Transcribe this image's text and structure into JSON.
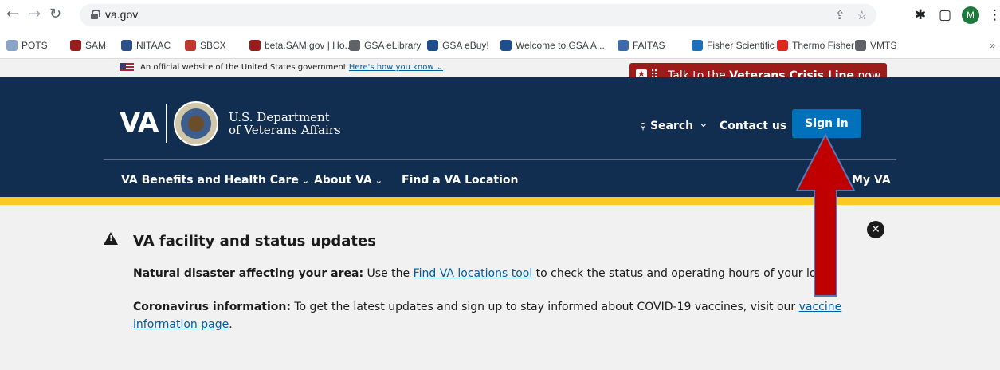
{
  "browser": {
    "url": "va.gov",
    "bookmarks": [
      {
        "label": "POTS",
        "icon_color": "#8aa4c9"
      },
      {
        "label": "SAM",
        "icon_color": "#9a1c1c"
      },
      {
        "label": "NITAAC",
        "icon_color": "#2d4f8a"
      },
      {
        "label": "SBCX",
        "icon_color": "#c2362d"
      },
      {
        "label": "beta.SAM.gov | Ho...",
        "icon_color": "#9a1c1c"
      },
      {
        "label": "GSA eLibrary",
        "icon_color": "#5f6368"
      },
      {
        "label": "GSA eBuy!",
        "icon_color": "#1f4e8c"
      },
      {
        "label": "Welcome to GSA A...",
        "icon_color": "#1f4e8c"
      },
      {
        "label": "FAITAS",
        "icon_color": "#3d6aa8"
      },
      {
        "label": "Fisher Scientific",
        "icon_color": "#1c6fb8"
      },
      {
        "label": "Thermo Fisher",
        "icon_color": "#e1251b"
      },
      {
        "label": "VMTS",
        "icon_color": "#5f6368"
      }
    ],
    "bookmarks_overflow": "»",
    "avatar_initial": "M"
  },
  "gov_banner": {
    "text": "An official website of the United States government",
    "link": "Here's how you know"
  },
  "crisis_line": {
    "prefix": "Talk to the",
    "strong": "Veterans Crisis Line",
    "suffix": "now"
  },
  "header": {
    "logo": "VA",
    "dept_line1": "U.S. Department",
    "dept_line2": "of Veterans Affairs",
    "search_label": "Search",
    "contact_label": "Contact us",
    "signin_label": "Sign in"
  },
  "nav": {
    "items": [
      {
        "label": "VA Benefits and Health Care"
      },
      {
        "label": "About VA"
      },
      {
        "label": "Find a VA Location"
      },
      {
        "label": "My VA"
      }
    ]
  },
  "alert": {
    "title": "VA facility and status updates",
    "p1_strong": "Natural disaster affecting your area:",
    "p1_pre": " Use the ",
    "p1_link": "Find VA locations tool",
    "p1_post": " to check the status and operating hours of your local VA facility.",
    "p2_strong": "Coronavirus information:",
    "p2_pre": " To get the latest updates and sign up to stay informed about COVID-19 vaccines, visit our ",
    "p2_link_line1": "vaccine",
    "p2_link_line2": "information page",
    "p2_post": "."
  },
  "colors": {
    "header_bg": "#112e51",
    "signin_bg": "#0071bb",
    "crisis_bg": "#9c1c1c",
    "gold": "#fac922",
    "annotation_arrow": "#c00000"
  }
}
